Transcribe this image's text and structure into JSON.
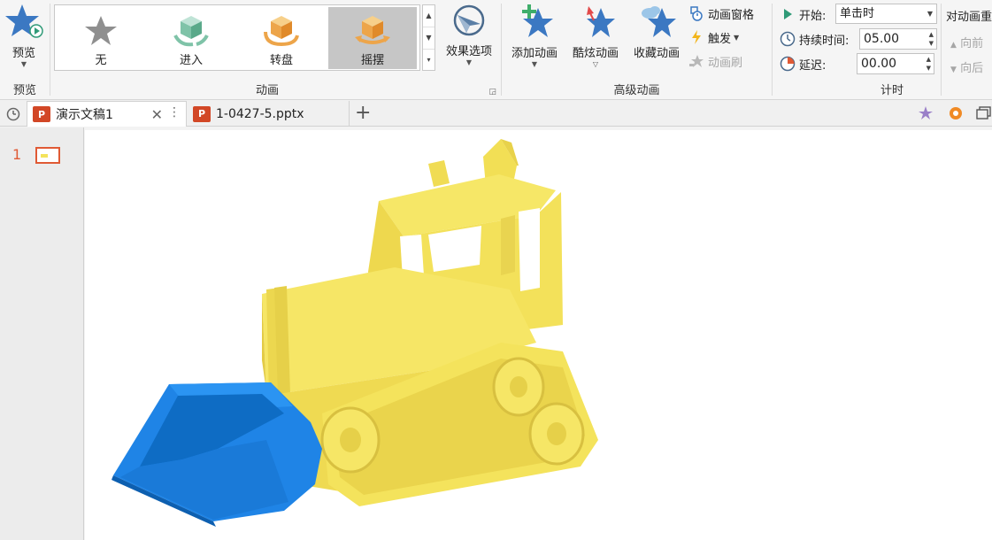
{
  "ribbon": {
    "preview": {
      "button_label": "预览",
      "group_label": "预览"
    },
    "animation": {
      "group_label": "动画",
      "gallery": [
        {
          "label": "无",
          "icon": "star-outline-icon"
        },
        {
          "label": "进入",
          "icon": "enter-cube-icon"
        },
        {
          "label": "转盘",
          "icon": "turntable-cube-icon"
        },
        {
          "label": "摇摆",
          "icon": "swing-cube-icon",
          "selected": true
        }
      ],
      "effect_options_label": "效果选项"
    },
    "advanced": {
      "group_label": "高级动画",
      "add_animation_label": "添加动画",
      "cool_animation_label": "酷炫动画",
      "favorite_animation_label": "收藏动画",
      "animation_pane_label": "动画窗格",
      "trigger_label": "触发",
      "animation_painter_label": "动画刷"
    },
    "timing": {
      "group_label": "计时",
      "start_label": "开始:",
      "start_value": "单击时",
      "duration_label": "持续时间:",
      "duration_value": "05.00",
      "delay_label": "延迟:",
      "delay_value": "00.00"
    },
    "reorder": {
      "title": "对动画重",
      "forward_label": "向前",
      "backward_label": "向后"
    }
  },
  "tabs": [
    {
      "title": "演示文稿1",
      "active": true
    },
    {
      "title": "1-0427-5.pptx",
      "active": false
    }
  ],
  "slides": {
    "numbers": [
      "1"
    ]
  },
  "colors": {
    "star_blue": "#3b78c2",
    "selection": "#c6c6c6",
    "ppt_red": "#d24726",
    "thumb_border": "#e05a35",
    "bulldozer_yellow": "#f4e35c",
    "bucket_blue": "#1f84e6"
  }
}
